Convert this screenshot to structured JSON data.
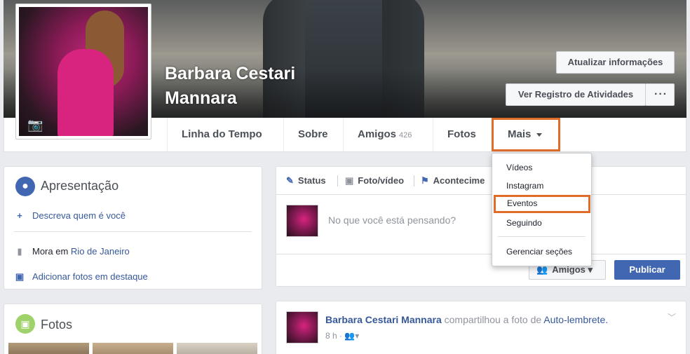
{
  "profile": {
    "name": "Barbara Cestari Mannara"
  },
  "cover_actions": {
    "update_info": "Atualizar informações",
    "activity_log": "Ver Registro de Atividades",
    "more_options": "···"
  },
  "nav": {
    "timeline": "Linha do Tempo",
    "about": "Sobre",
    "friends": "Amigos",
    "friends_count": "426",
    "photos": "Fotos",
    "more": "Mais"
  },
  "dropdown": {
    "items": [
      "Vídeos",
      "Instagram",
      "Eventos",
      "Seguindo"
    ],
    "manage": "Gerenciar seções",
    "highlighted": "Eventos"
  },
  "intro": {
    "title": "Apresentação",
    "describe": "Descreva quem é você",
    "lives_prefix": "Mora em",
    "lives_city": "Rio de Janeiro",
    "add_photos": "Adicionar fotos em destaque"
  },
  "photos_card": {
    "title": "Fotos"
  },
  "composer": {
    "tab_status": "Status",
    "tab_photo": "Foto/vídeo",
    "tab_event": "Acontecime",
    "placeholder": "No que você está pensando?",
    "audience": "Amigos",
    "publish": "Publicar"
  },
  "post": {
    "author": "Barbara Cestari Mannara",
    "action": "compartilhou a foto de",
    "target": "Auto-lembrete.",
    "time": "8 h ·"
  },
  "colors": {
    "fb_blue": "#4267b2",
    "link_blue": "#365899",
    "highlight_orange": "#e06c2a"
  }
}
